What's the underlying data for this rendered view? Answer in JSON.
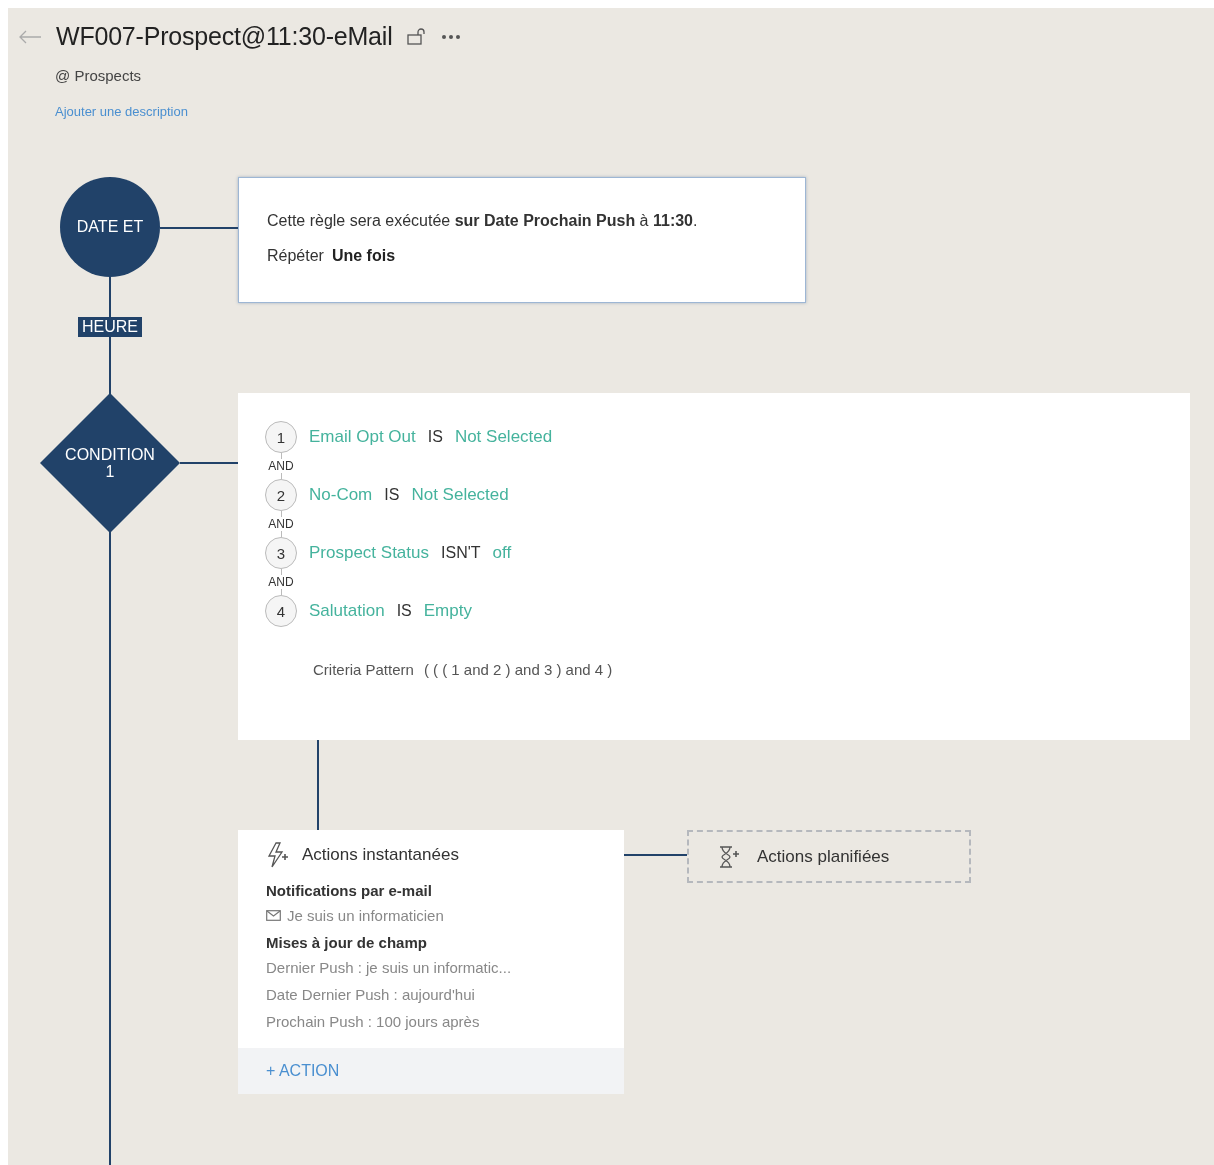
{
  "header": {
    "title": "WF007-Prospect@11:30-eMail",
    "module": "@ Prospects",
    "description_link": "Ajouter une description"
  },
  "trigger": {
    "node_label": "DATE ET",
    "node_sublabel": "HEURE",
    "sentence": "Cette règle sera exécutée **sur Date Prochain Push** à **11:30**.",
    "repeat_label": "Répéter",
    "repeat_value": "Une fois"
  },
  "condition": {
    "node_label": "CONDITION",
    "node_number": "1",
    "criteria": [
      {
        "number": "1",
        "field": "Email Opt Out",
        "operator": "IS",
        "value": "Not Selected",
        "joiner": "AND"
      },
      {
        "number": "2",
        "field": "No-Com",
        "operator": "IS",
        "value": "Not Selected",
        "joiner": "AND"
      },
      {
        "number": "3",
        "field": "Prospect Status",
        "operator": "ISN'T",
        "value": "off",
        "joiner": "AND"
      },
      {
        "number": "4",
        "field": "Salutation",
        "operator": "IS",
        "value": "Empty"
      }
    ],
    "pattern_label": "Criteria Pattern",
    "pattern": "( ( ( 1 and 2 ) and 3 ) and 4 )"
  },
  "instant_actions": {
    "title": "Actions instantanées",
    "groups": [
      {
        "title": "Notifications par e-mail",
        "items": [
          {
            "kind": "email",
            "text": "Je suis un informaticien"
          }
        ]
      },
      {
        "title": "Mises à jour de champ",
        "items": [
          {
            "kind": "field",
            "text": "Dernier Push : je suis un informatic..."
          },
          {
            "kind": "field",
            "text": "Date Dernier Push : aujourd'hui"
          },
          {
            "kind": "field",
            "text": "Prochain Push : 100 jours après"
          }
        ]
      }
    ],
    "add_button": "+ ACTION"
  },
  "scheduled_actions": {
    "title": "Actions planifiées"
  }
}
